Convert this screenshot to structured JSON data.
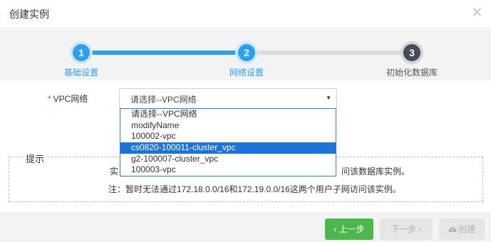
{
  "dialog": {
    "title": "创建实例",
    "close_glyph": "✕"
  },
  "steps": [
    {
      "number": "1",
      "label": "基础设置",
      "state": "done"
    },
    {
      "number": "2",
      "label": "网络设置",
      "state": "active"
    },
    {
      "number": "3",
      "label": "初始化数据库",
      "state": "pending"
    }
  ],
  "form": {
    "required_mark": "*",
    "vpc_label": "VPC网络",
    "vpc_select": {
      "value": "请选择--VPC网络",
      "caret": "▼",
      "options": [
        "请选择--VPC网络",
        "modifyName",
        "100002-vpc",
        "cs0820-100011-cluster_vpc",
        "g2-100007-cluster_vpc",
        "100003-vpc"
      ],
      "highlighted_index": 3
    }
  },
  "tip": {
    "title": "提示",
    "line1_start": "实",
    "line1_end": "问该数据库实例。",
    "line2": "注：暂时无法通过172.18.0.0/16和172.19.0.0/16这两个用户子网访问该实例。"
  },
  "footer": {
    "prev_label": "‹ 上一步",
    "next_label": "下一步 ›",
    "create_label": "创建"
  },
  "colors": {
    "accent": "#2aa0ef",
    "pending_step": "#444c55",
    "prev_button": "#4cb84c",
    "dropdown_highlight": "#1e73d8"
  }
}
